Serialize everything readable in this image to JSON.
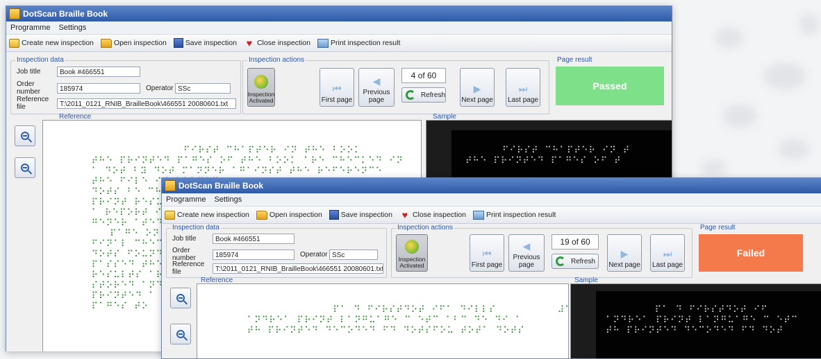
{
  "window1": {
    "title": "DotScan Braille Book",
    "menu": [
      "Programme",
      "Settings"
    ],
    "toolbar": [
      "Create new inspection",
      "Open inspection",
      "Save inspection",
      "Close inspection",
      "Print inspection result"
    ],
    "inspection_data": {
      "label": "Inspection data",
      "job_title_label": "Job title",
      "job_title": "Book #466551",
      "order_number_label": "Order number",
      "order_number": "185974",
      "operator_label": "Operator",
      "operator": "SSc",
      "reference_file_label": "Reference file",
      "reference_file": "T:\\2011_0121_RNIB_BrailleBook\\466551 20080601.txt"
    },
    "inspection_actions": {
      "label": "Inspection actions",
      "activated": "Inspection Activated",
      "first": "First page",
      "previous": "Previous page",
      "page_indicator": "4 of 60",
      "refresh": "Refresh",
      "next": "Next page",
      "last": "Last page"
    },
    "page_result": {
      "label": "Page result",
      "text": "Passed",
      "color": "#7fe08a"
    },
    "reference_label": "Reference",
    "sample_label": "Sample",
    "braille_ref": "                 ⠋⠊⠗⠎⠞ ⠉⠓⠁⠏⠞⠑⠗ ⠊⠝ ⠞⠓⠑ ⠃⠕⠕⠅          ⠼⠁⠉\n  ⠞⠓⠑ ⠏⠗⠊⠝⠞⠑⠙ ⠏⠁⠛⠑⠎ ⠕⠋ ⠞⠓⠑ ⠃⠕⠕⠅ ⠁⠗⠑ ⠉⠓⠑⠉⠅⠑⠙ ⠊⠝\n  ⠁ ⠙⠕⠞ ⠃⠽ ⠙⠕⠞ ⠍⠁⠝⠝⠑⠗ ⠁⠛⠁⠊⠝⠎⠞ ⠞⠓⠑ ⠗⠑⠋⠑⠗⠑⠝⠉⠑\n  ⠞⠓⠑ ⠋⠊⠇⠑ ⠊⠎ ⠇⠕⠁⠙⠑⠙\n  ⠙⠕⠞⠎ ⠃⠑ ⠉⠓⠑⠉⠅\n  ⠏⠗⠊⠝⠞ ⠗⠑⠎⠥⠇⠞\n  ⠁ ⠗⠑⠏⠕⠗⠞ ⠊⠎\n  ⠛⠑⠝⠑⠗ ⠁⠞⠑⠙\n     ⠏⠁⠛⠑ ⠕⠝⠑\n  ⠋⠊⠝⠁⠇ ⠉⠓⠑⠉⠅\n  ⠙⠕⠞⠎ ⠋⠕⠥⠝⠙\n  ⠏⠁⠎⠎⠑⠙ ⠞⠓⠑\n  ⠗⠑⠎⠥⠇⠞⠎ ⠁⠗⠑\n  ⠎⠞⠕⠗⠑⠙ ⠁⠝⠙\n  ⠏⠗⠊⠝⠞⠑⠙ ⠁\n  ⠏⠁⠛⠑⠎ ⠞⠕",
    "braille_sample": "      ⠋⠊⠗⠎⠞ ⠉⠓⠁⠏⠞⠑⠗ ⠊⠝ ⠞\n⠞⠓⠑ ⠏⠗⠊⠝⠞⠑⠙ ⠏⠁⠛⠑⠎ ⠕⠋ ⠞"
  },
  "window2": {
    "title": "DotScan Braille Book",
    "menu": [
      "Programme",
      "Settings"
    ],
    "toolbar": [
      "Create new inspection",
      "Open inspection",
      "Save inspection",
      "Close inspection",
      "Print inspection result"
    ],
    "inspection_data": {
      "label": "Inspection data",
      "job_title_label": "Job title",
      "job_title": "Book #466551",
      "order_number_label": "Order number",
      "order_number": "185974",
      "operator_label": "Operator",
      "operator": "SSc",
      "reference_file_label": "Reference file",
      "reference_file": "T:\\2011_0121_RNIB_BrailleBook\\466551 20080601.txt"
    },
    "inspection_actions": {
      "label": "Inspection actions",
      "activated": "Inspection Activated",
      "first": "First page",
      "previous": "Previous page",
      "page_indicator": "19 of 60",
      "refresh": "Refresh",
      "next": "Next page",
      "last": "Last page"
    },
    "page_result": {
      "label": "Page result",
      "text": "Failed",
      "color": "#f47a4c"
    },
    "reference_label": "Reference",
    "sample_label": "Sample",
    "braille_ref": "                ⠏⠁ ⠙ ⠋⠊⠗⠎⠞⠙⠕⠞ ⠊⠋⠁ ⠙⠊⠇⠇⠎          ⠼⠁⠉\n  ⠁⠝⠙⠗⠑⠁ ⠏⠗⠊⠝⠞ ⠇⠁⠝⠛⠥⠁⠛⠑ ⠉ ⠑⠞⠉ ⠁⠃⠉ ⠙⠑ ⠙⠊ ⠁\n  ⠞⠓ ⠏⠗⠊⠝⠞⠑⠙ ⠙⠑⠉⠕⠙⠑⠙ ⠋⠙ ⠙⠕⠞⠎⠋⠕⠥ ⠞⠕⠞⠁ ⠙⠕⠞⠎",
    "braille_sample": "        ⠏⠁ ⠙ ⠋⠊⠗⠎⠞⠙⠕⠞ ⠊⠋\n⠁⠝⠙⠗⠑⠁ ⠏⠗⠊⠝⠞ ⠇⠁⠝⠛⠥⠁⠛⠑ ⠉ ⠑⠞⠉\n⠞⠓ ⠏⠗⠊⠝⠞⠑⠙ ⠙⠑⠉⠕⠙⠑⠙ ⠋⠙ ⠙⠕⠞"
  }
}
